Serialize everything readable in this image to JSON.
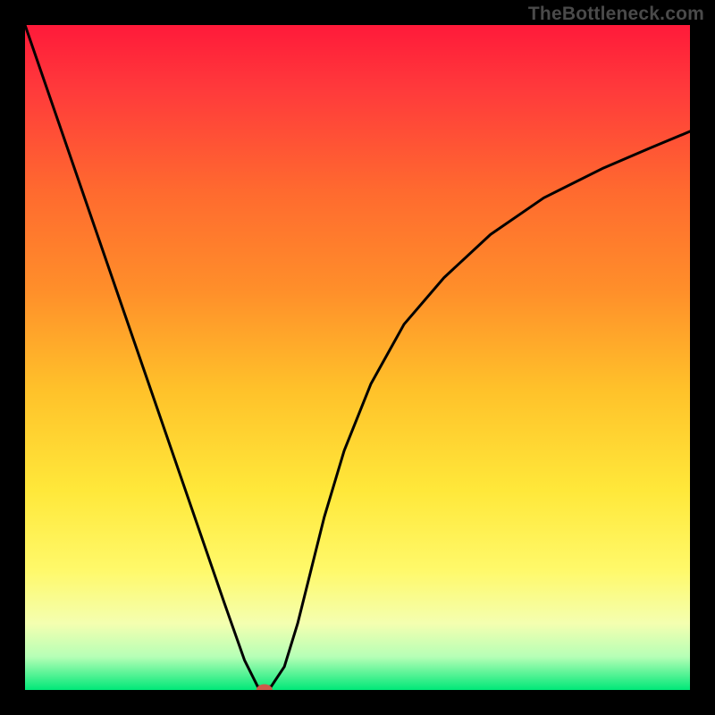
{
  "watermark": "TheBottleneck.com",
  "chart_data": {
    "type": "line",
    "title": "",
    "xlabel": "",
    "ylabel": "",
    "xlim": [
      0,
      100
    ],
    "ylim": [
      0,
      100
    ],
    "background_gradient": {
      "stops": [
        {
          "offset": 0,
          "color": "#ff1a3a"
        },
        {
          "offset": 10,
          "color": "#ff3b3b"
        },
        {
          "offset": 25,
          "color": "#ff6a2f"
        },
        {
          "offset": 40,
          "color": "#ff8f2a"
        },
        {
          "offset": 55,
          "color": "#ffc22a"
        },
        {
          "offset": 70,
          "color": "#ffe83a"
        },
        {
          "offset": 82,
          "color": "#fff96a"
        },
        {
          "offset": 90,
          "color": "#f4ffb0"
        },
        {
          "offset": 95,
          "color": "#b6ffb6"
        },
        {
          "offset": 100,
          "color": "#00e878"
        }
      ]
    },
    "series": [
      {
        "name": "bottleneck-curve",
        "x": [
          0,
          5,
          10,
          15,
          20,
          25,
          30,
          33,
          35,
          37,
          39,
          41,
          43,
          45,
          48,
          52,
          57,
          63,
          70,
          78,
          87,
          94,
          100
        ],
        "y": [
          100,
          85.5,
          71,
          56.5,
          42,
          27.5,
          13,
          4.5,
          0.5,
          0.5,
          3.5,
          10,
          18,
          26,
          36,
          46,
          55,
          62,
          68.5,
          74,
          78.5,
          81.5,
          84
        ]
      }
    ],
    "marker": {
      "name": "optimal-point",
      "x": 36,
      "y": 0,
      "color": "#cc5a4a"
    }
  }
}
